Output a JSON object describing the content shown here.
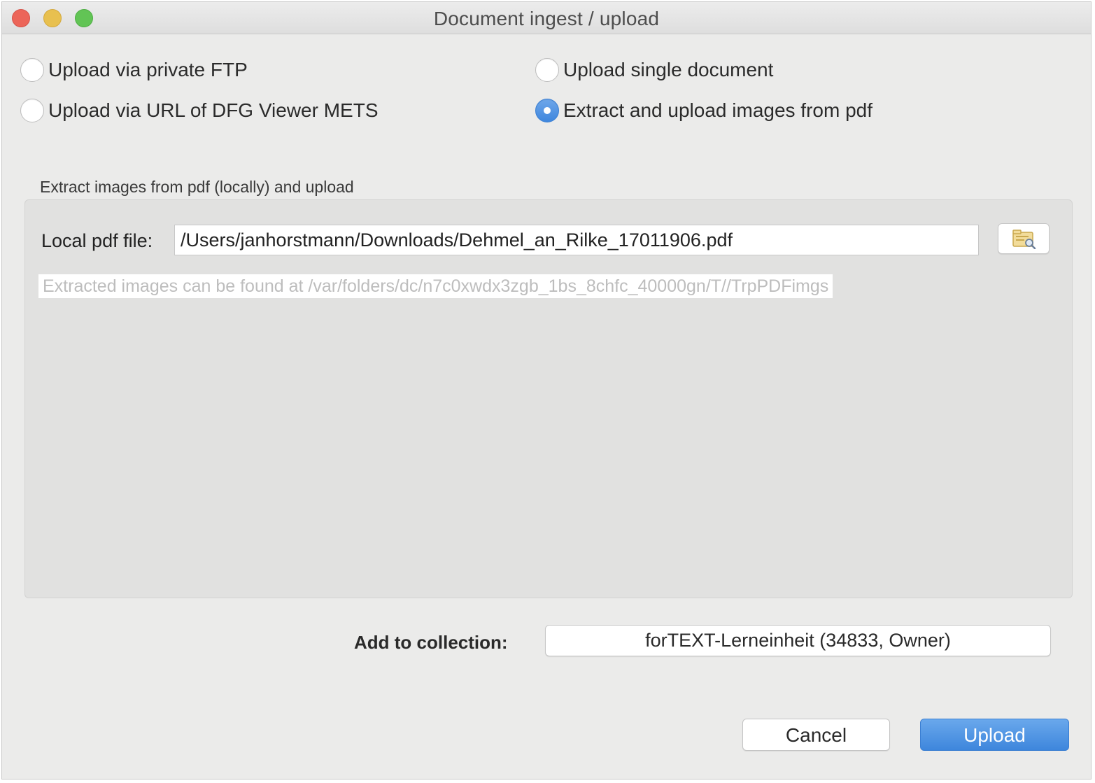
{
  "window": {
    "title": "Document ingest / upload"
  },
  "upload_modes": [
    {
      "label": "Upload via private FTP",
      "selected": false
    },
    {
      "label": "Upload via URL of DFG Viewer METS",
      "selected": false
    },
    {
      "label": "Upload single document",
      "selected": false
    },
    {
      "label": "Extract and upload images from pdf",
      "selected": true
    }
  ],
  "pdf_group": {
    "title": "Extract images from pdf (locally) and upload",
    "file_label": "Local pdf file:",
    "file_value": "/Users/janhorstmann/Downloads/Dehmel_an_Rilke_17011906.pdf",
    "browse_icon": "folder-search-icon",
    "info_text": "Extracted images can be found at /var/folders/dc/n7c0xwdx3zgb_1bs_8chfc_40000gn/T//TrpPDFimgs"
  },
  "collection": {
    "label": "Add to collection:",
    "selected": "forTEXT-Lerneinheit (34833, Owner)"
  },
  "buttons": {
    "cancel": "Cancel",
    "upload": "Upload"
  },
  "colors": {
    "accent": "#4a8fe0",
    "close": "#ec6559",
    "minimize": "#e8c04f",
    "zoom": "#62c455"
  }
}
